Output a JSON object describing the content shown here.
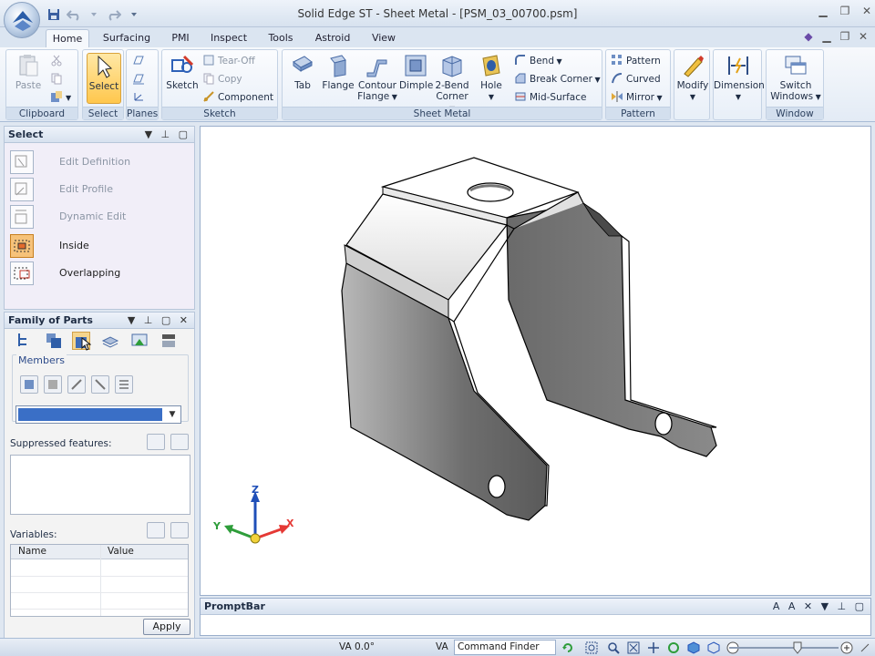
{
  "title": "Solid Edge ST - Sheet Metal - [PSM_03_00700.psm]",
  "tabs": [
    "Home",
    "Surfacing",
    "PMI",
    "Inspect",
    "Tools",
    "Astroid",
    "View"
  ],
  "active_tab": "Home",
  "ribbon": {
    "clipboard": {
      "title": "Clipboard",
      "paste": "Paste"
    },
    "select": {
      "title": "Select",
      "select": "Select"
    },
    "planes": {
      "title": "Planes"
    },
    "sketch": {
      "title": "Sketch",
      "sketch": "Sketch",
      "tear_off": "Tear-Off",
      "copy": "Copy",
      "component": "Component"
    },
    "sheet_metal": {
      "title": "Sheet Metal",
      "tab": "Tab",
      "flange": "Flange",
      "contour_flange_1": "Contour",
      "contour_flange_2": "Flange",
      "dimple": "Dimple",
      "two_bend_1": "2-Bend",
      "two_bend_2": "Corner",
      "hole": "Hole",
      "bend": "Bend",
      "break_corner": "Break Corner",
      "mid_surface": "Mid-Surface"
    },
    "pattern": {
      "title": "Pattern",
      "pattern": "Pattern",
      "curved": "Curved",
      "mirror": "Mirror"
    },
    "modify": {
      "modify": "Modify"
    },
    "dimension": {
      "dimension": "Dimension"
    },
    "window": {
      "title": "Window",
      "switch_1": "Switch",
      "switch_2": "Windows"
    }
  },
  "select_panel": {
    "title": "Select",
    "items": [
      {
        "label": "Edit Definition",
        "enabled": false
      },
      {
        "label": "Edit Profile",
        "enabled": false
      },
      {
        "label": "Dynamic Edit",
        "enabled": false
      },
      {
        "label": "Inside",
        "enabled": true
      },
      {
        "label": "Overlapping",
        "enabled": true
      }
    ]
  },
  "family_panel": {
    "title": "Family of Parts",
    "members_label": "Members",
    "suppressed_label": "Suppressed features:",
    "variables_label": "Variables:",
    "col_name": "Name",
    "col_value": "Value",
    "apply": "Apply"
  },
  "viewport": {
    "triad": {
      "x": "X",
      "y": "Y",
      "z": "Z"
    }
  },
  "promptbar": {
    "title": "PromptBar"
  },
  "statusbar": {
    "va": "VA 0.0°",
    "va_label": "VA",
    "command_finder": "Command Finder"
  },
  "colors": {
    "accent": "#3a6fc6",
    "triad_x": "#e53935",
    "triad_y": "#2e9d3a",
    "triad_z": "#1f4fb8",
    "select_highlight": "#ffc74d"
  }
}
